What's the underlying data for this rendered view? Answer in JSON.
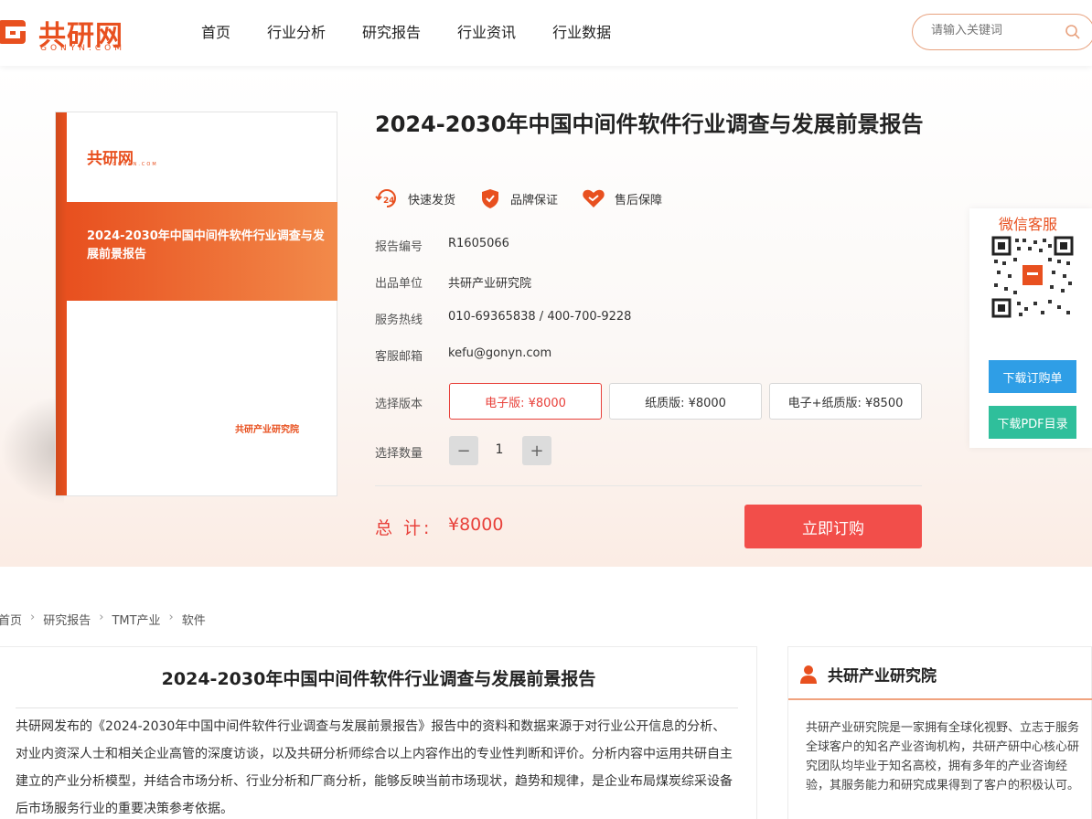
{
  "header": {
    "logo_cn": "共研网",
    "logo_en": "GONYN.COM",
    "nav": [
      "首页",
      "行业分析",
      "研究报告",
      "行业资讯",
      "行业数据"
    ],
    "search_placeholder": "请输入关键词"
  },
  "book": {
    "logo_cn": "共研网",
    "logo_en": "GONYN.COM",
    "title": "2024-2030年中国中间件软件行业调查与发展前景报告",
    "publisher": "共研产业研究院"
  },
  "product": {
    "title": "2024-2030年中国中间件软件行业调查与发展前景报告",
    "badges": [
      "快速发货",
      "品牌保证",
      "售后保障"
    ],
    "fields": [
      {
        "label": "报告编号",
        "value": "R1605066"
      },
      {
        "label": "出品单位",
        "value": "共研产业研究院"
      },
      {
        "label": "服务热线",
        "value": "010-69365838 / 400-700-9228"
      },
      {
        "label": "客服邮箱",
        "value": "kefu@gonyn.com"
      }
    ],
    "version_label": "选择版本",
    "versions": [
      "电子版: ¥8000",
      "纸质版: ¥8000",
      "电子+纸质版: ¥8500"
    ],
    "selected_version": 0,
    "qty_label": "选择数量",
    "qty_minus": "−",
    "qty_value": "1",
    "qty_plus": "+",
    "total_label": "总 计:",
    "total_value": "¥8000",
    "buy_label": "立即订购"
  },
  "wechat": {
    "title": "微信客服",
    "download_order": "下载订购单",
    "download_pdf": "下载PDF目录"
  },
  "breadcrumb": [
    "首页",
    "研究报告",
    "TMT产业",
    "软件"
  ],
  "article": {
    "title": "2024-2030年中国中间件软件行业调查与发展前景报告",
    "body": "共研网发布的《2024-2030年中国中间件软件行业调查与发展前景报告》报告中的资料和数据来源于对行业公开信息的分析、对业内资深人士和相关企业高管的深度访谈，以及共研分析师综合以上内容作出的专业性判断和评价。分析内容中运用共研自主建立的产业分析模型，并结合市场分析、行业分析和厂商分析，能够反映当前市场现状，趋势和规律，是企业布局煤炭综采设备后市场服务行业的重要决策参考依据。"
  },
  "side": {
    "title": "共研产业研究院",
    "body": "共研产业研究院是一家拥有全球化视野、立志于服务全球客户的知名产业咨询机构，共研产研中心核心研究团队均毕业于知名高校，拥有多年的产业咨询经验，其服务能力和研究成果得到了客户的积极认可。"
  },
  "colors": {
    "brand": "#e8501f",
    "price_red": "#e8403a",
    "buy_button": "#f24e4a",
    "download_order_button": "#2f9ee6",
    "download_pdf_button": "#2fbf9b"
  }
}
